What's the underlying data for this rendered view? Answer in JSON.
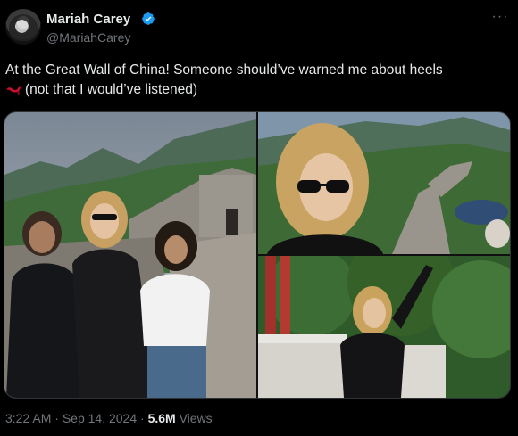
{
  "author": {
    "name": "Mariah Carey",
    "handle": "@MariahCarey",
    "verified_color": "#1d9bf0"
  },
  "tweet": {
    "text_line1": "At the Great Wall of China! Someone should’ve warned me about heels",
    "text_line2": "(not that I would’ve listened)",
    "emoji_icon": "high-heel-icon"
  },
  "media": {
    "photos": [
      {
        "name": "photo-group-great-wall"
      },
      {
        "name": "photo-sunglasses-closeup"
      },
      {
        "name": "photo-waving-pavilion"
      }
    ]
  },
  "meta": {
    "time": "3:22 AM",
    "date": "Sep 14, 2024",
    "views_count": "5.6M",
    "views_label": "Views",
    "separator": "·"
  },
  "colors": {
    "background": "#000000",
    "text": "#e7e9ea",
    "muted": "#71767b"
  }
}
